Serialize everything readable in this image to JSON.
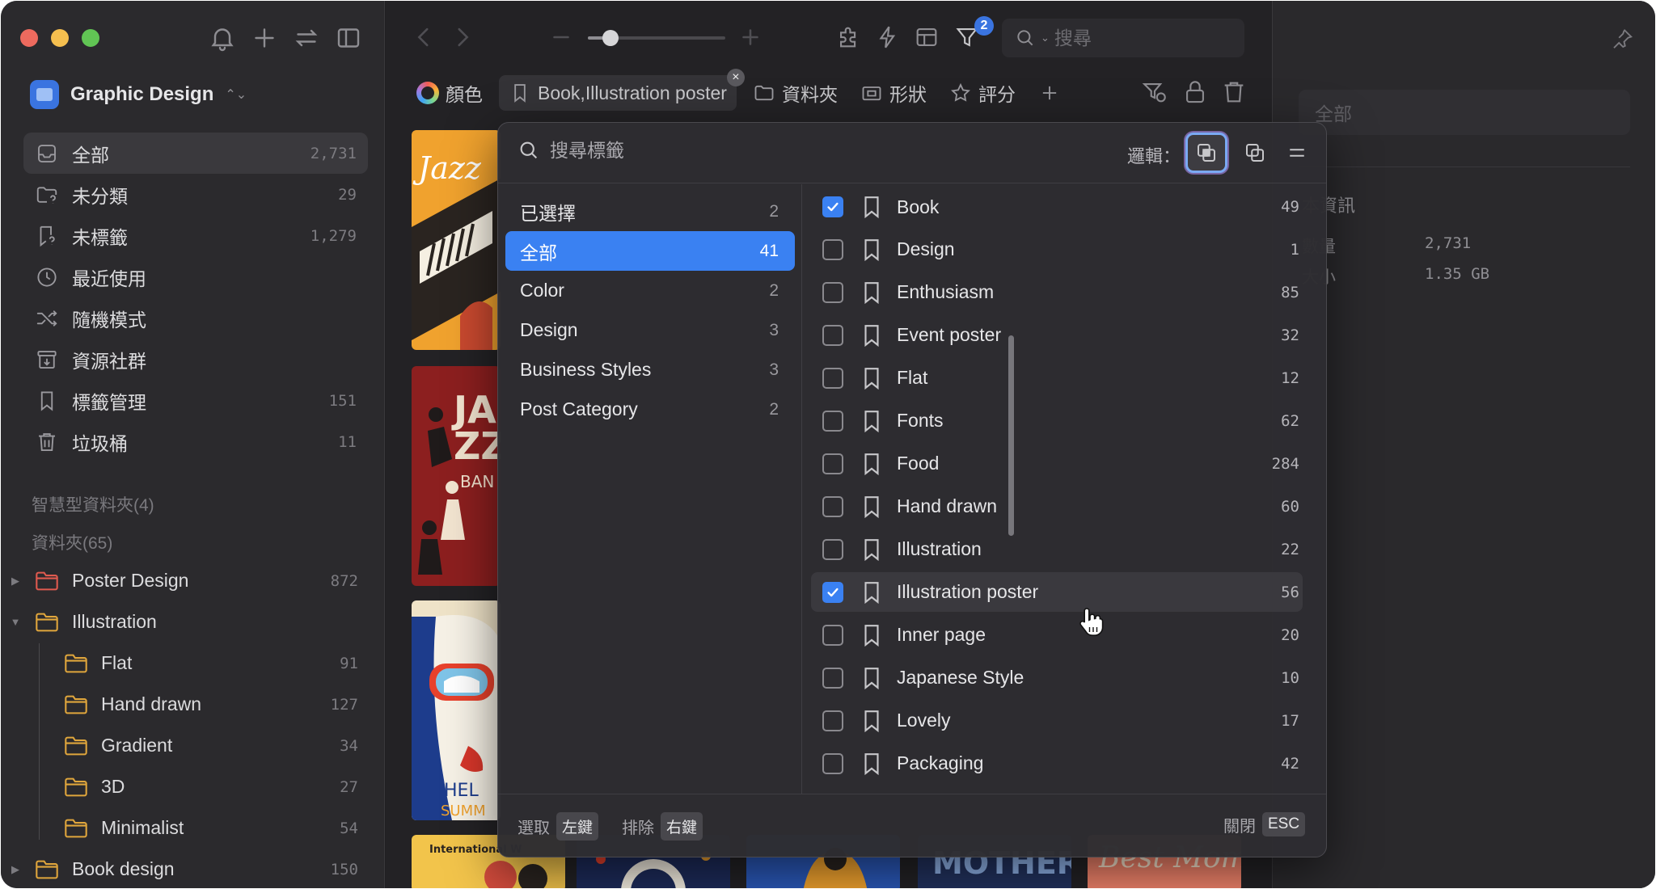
{
  "app": {
    "library_name": "Graphic Design"
  },
  "sidebar": {
    "nav": [
      {
        "label": "全部",
        "count": "2,731",
        "icon": "inbox-icon"
      },
      {
        "label": "未分類",
        "count": "29",
        "icon": "folder-question-icon"
      },
      {
        "label": "未標籤",
        "count": "1,279",
        "icon": "tag-question-icon"
      },
      {
        "label": "最近使用",
        "count": "",
        "icon": "clock-icon"
      },
      {
        "label": "隨機模式",
        "count": "",
        "icon": "shuffle-icon"
      },
      {
        "label": "資源社群",
        "count": "",
        "icon": "archive-icon"
      },
      {
        "label": "標籤管理",
        "count": "151",
        "icon": "bookmark-icon"
      },
      {
        "label": "垃圾桶",
        "count": "11",
        "icon": "trash-icon"
      }
    ],
    "smart_folders_title": "智慧型資料夾(4)",
    "folders_title": "資料夾(65)",
    "folders": [
      {
        "label": "Poster Design",
        "count": "872",
        "color": "#e05a4f"
      },
      {
        "label": "Illustration",
        "count": "",
        "color": "#e0a63c"
      },
      {
        "label": "Flat",
        "count": "91",
        "color": "#e0a63c"
      },
      {
        "label": "Hand drawn",
        "count": "127",
        "color": "#e0a63c"
      },
      {
        "label": "Gradient",
        "count": "34",
        "color": "#e0a63c"
      },
      {
        "label": "3D",
        "count": "27",
        "color": "#e0a63c"
      },
      {
        "label": "Minimalist",
        "count": "54",
        "color": "#e0a63c"
      },
      {
        "label": "Book design",
        "count": "150",
        "color": "#e0a63c"
      }
    ]
  },
  "toolbar": {
    "search_placeholder": "搜尋",
    "filter_badge": "2",
    "zoom_level": 0.12
  },
  "filterbar": {
    "color": "顏色",
    "tags": "Book,Illustration poster",
    "folder": "資料夾",
    "shape": "形狀",
    "rating": "評分"
  },
  "info_panel": {
    "input_placeholder": "全部",
    "section_title": "本資訊",
    "rows": [
      {
        "label": "數量",
        "value": "2,731"
      },
      {
        "label": "大小",
        "value": "1.35 GB"
      }
    ]
  },
  "tag_popup": {
    "search_placeholder": "搜尋標籤",
    "logic_label": "邏輯：",
    "categories": [
      {
        "label": "已選擇",
        "count": "2"
      },
      {
        "label": "全部",
        "count": "41",
        "active": true
      },
      {
        "label": "Color",
        "count": "2"
      },
      {
        "label": "Design",
        "count": "3"
      },
      {
        "label": "Business Styles",
        "count": "3"
      },
      {
        "label": "Post Category",
        "count": "2"
      }
    ],
    "tags": [
      {
        "label": "Book",
        "count": "49",
        "checked": true
      },
      {
        "label": "Design",
        "count": "1",
        "checked": false
      },
      {
        "label": "Enthusiasm",
        "count": "85",
        "checked": false
      },
      {
        "label": "Event poster",
        "count": "32",
        "checked": false
      },
      {
        "label": "Flat",
        "count": "12",
        "checked": false
      },
      {
        "label": "Fonts",
        "count": "62",
        "checked": false
      },
      {
        "label": "Food",
        "count": "284",
        "checked": false
      },
      {
        "label": "Hand drawn",
        "count": "60",
        "checked": false
      },
      {
        "label": "Illustration",
        "count": "22",
        "checked": false
      },
      {
        "label": "Illustration poster",
        "count": "56",
        "checked": true
      },
      {
        "label": "Inner page",
        "count": "20",
        "checked": false
      },
      {
        "label": "Japanese Style",
        "count": "10",
        "checked": false
      },
      {
        "label": "Lovely",
        "count": "17",
        "checked": false
      },
      {
        "label": "Packaging",
        "count": "42",
        "checked": false
      }
    ],
    "footer": {
      "select_label": "選取",
      "select_key": "左鍵",
      "exclude_label": "排除",
      "exclude_key": "右鍵",
      "close_label": "關閉",
      "close_key": "ESC"
    }
  }
}
